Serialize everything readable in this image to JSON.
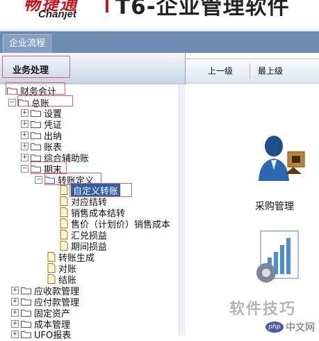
{
  "banner": {
    "logo_cn": "畅捷通",
    "logo_en": "Chanjet",
    "title": "T6-企业管理软件"
  },
  "nav": {
    "tab": "企业流程"
  },
  "left_panel": {
    "header": "业务处理"
  },
  "right_panel": {
    "btn_up": "上一级",
    "btn_top": "最上级",
    "purchase_label": "采购管理"
  },
  "tree": {
    "root": "财务会计",
    "gl": "总账",
    "setup": "设置",
    "voucher": "凭证",
    "cashier": "出纳",
    "ledger": "账表",
    "aux": "综合辅助账",
    "period_end": "期末",
    "transfer_def": "转账定义",
    "custom_transfer": "自定义转账",
    "contra_transfer": "对应结转",
    "cogs_transfer": "销售成本结转",
    "price_cost": "售价（计划价）销售成本",
    "fx_gainloss": "汇兑损益",
    "period_gainloss": "期间损益",
    "transfer_gen": "转账生成",
    "reconcile": "对账",
    "close": "结账",
    "ar": "应收款管理",
    "ap": "应付款管理",
    "fixed_assets": "固定资产",
    "cost_mgmt": "成本管理",
    "ufo": "UFO报表"
  },
  "watermark": "软件技巧",
  "badge": {
    "php": "php",
    "site": "中文网"
  },
  "colors": {
    "nav": "#6e8cb2",
    "selected": "#2f5ea8",
    "annotation": "#e25c6a",
    "brand": "#c8161d"
  }
}
